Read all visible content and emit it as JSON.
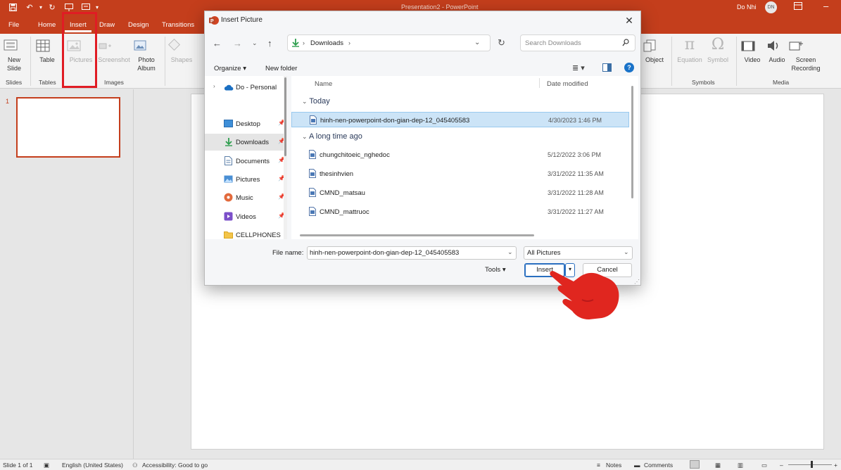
{
  "app": {
    "window_title": "Presentation2 - PowerPoint",
    "user_name": "Do Nhi",
    "user_initials": "DN"
  },
  "tabs": [
    "File",
    "Home",
    "Insert",
    "Draw",
    "Design",
    "Transitions"
  ],
  "ribbon": {
    "new_slide": "New Slide",
    "slides_group": "Slides",
    "table": "Table",
    "tables_group": "Tables",
    "pictures": "Pictures",
    "screenshot": "Screenshot",
    "photo_album": "Photo Album",
    "images_group": "Images",
    "shapes": "Shapes",
    "object": "Object",
    "equation": "Equation",
    "symbol": "Symbol",
    "symbols_group": "Symbols",
    "video": "Video",
    "audio": "Audio",
    "screen_recording": "Screen Recording",
    "media_group": "Media"
  },
  "thumbnails": {
    "slide_number": "1"
  },
  "dialog": {
    "title": "Insert Picture",
    "breadcrumb": "Downloads",
    "search_placeholder": "Search Downloads",
    "organize": "Organize",
    "new_folder": "New folder",
    "nav": {
      "onedrive": "Do - Personal",
      "items": [
        {
          "label": "Desktop"
        },
        {
          "label": "Downloads"
        },
        {
          "label": "Documents"
        },
        {
          "label": "Pictures"
        },
        {
          "label": "Music"
        },
        {
          "label": "Videos"
        },
        {
          "label": "CELLPHONES"
        }
      ]
    },
    "columns": {
      "name": "Name",
      "date": "Date modified"
    },
    "groups": {
      "today": "Today",
      "long_ago": "A long time ago"
    },
    "files": [
      {
        "name": "hinh-nen-powerpoint-don-gian-dep-12_045405583",
        "date": "4/30/2023 1:46 PM"
      },
      {
        "name": "chungchitoeic_nghedoc",
        "date": "5/12/2022 3:06 PM"
      },
      {
        "name": "thesinhvien",
        "date": "3/31/2022 11:35 AM"
      },
      {
        "name": "CMND_matsau",
        "date": "3/31/2022 11:28 AM"
      },
      {
        "name": "CMND_mattruoc",
        "date": "3/31/2022 11:27 AM"
      }
    ],
    "file_name_label": "File name:",
    "file_name_value": "hinh-nen-powerpoint-don-gian-dep-12_045405583",
    "file_type": "All Pictures",
    "tools": "Tools",
    "insert": "Insert",
    "cancel": "Cancel"
  },
  "status": {
    "slide": "Slide 1 of 1",
    "language": "English (United States)",
    "accessibility": "Accessibility: Good to go",
    "notes": "Notes",
    "comments": "Comments"
  },
  "colors": {
    "accent": "#c43e1c",
    "highlight": "#e01c24",
    "selection": "#cce4f7",
    "pointer_hand": "#e0261f"
  }
}
